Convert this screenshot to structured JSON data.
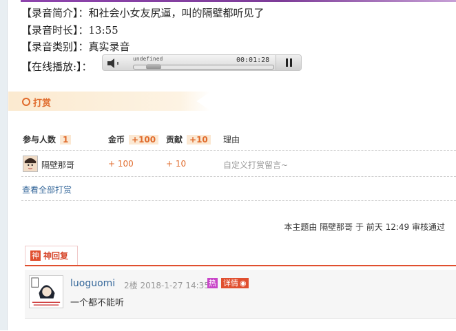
{
  "info": {
    "intro": "【录音简介】：和社会小女友尻逼，叫的隔壁都听见了",
    "duration": "【录音时长】：13:55",
    "category": "【录音类别】：真实录音",
    "online_play": "【在线播放:】："
  },
  "player": {
    "track_label": "undefined",
    "elapsed": "00:01:28",
    "progress": 0.1
  },
  "reward": {
    "title": "打赏",
    "headers": {
      "participants_label": "参与人数",
      "participants_count": "1",
      "gold_label": "金币",
      "gold_total": "+100",
      "contribution_label": "贡献",
      "contribution_total": "+10",
      "reason_label": "理由"
    },
    "rows": [
      {
        "name": "隔壁那哥",
        "gold": "+ 100",
        "contribution": "+ 10",
        "reason": "自定义打赏留言~"
      }
    ],
    "view_all": "查看全部打赏"
  },
  "audit_text": "本主题由 隔壁那哥 于 前天 12:49 审核通过",
  "god_reply": {
    "badge": "神",
    "tab_label": "神回复",
    "user": "luoguomi",
    "meta": "2楼 2018-1-27 14:35",
    "hot_badge": "热",
    "detail_label": "详情",
    "content": "一个都不能听",
    "avatar_text": "香吧中文域名 香吧论坛.com"
  },
  "colors": {
    "accent": "#e06b2c",
    "link": "#336699",
    "god_red": "#e04f2f",
    "top_bar": "#8e44ad"
  }
}
